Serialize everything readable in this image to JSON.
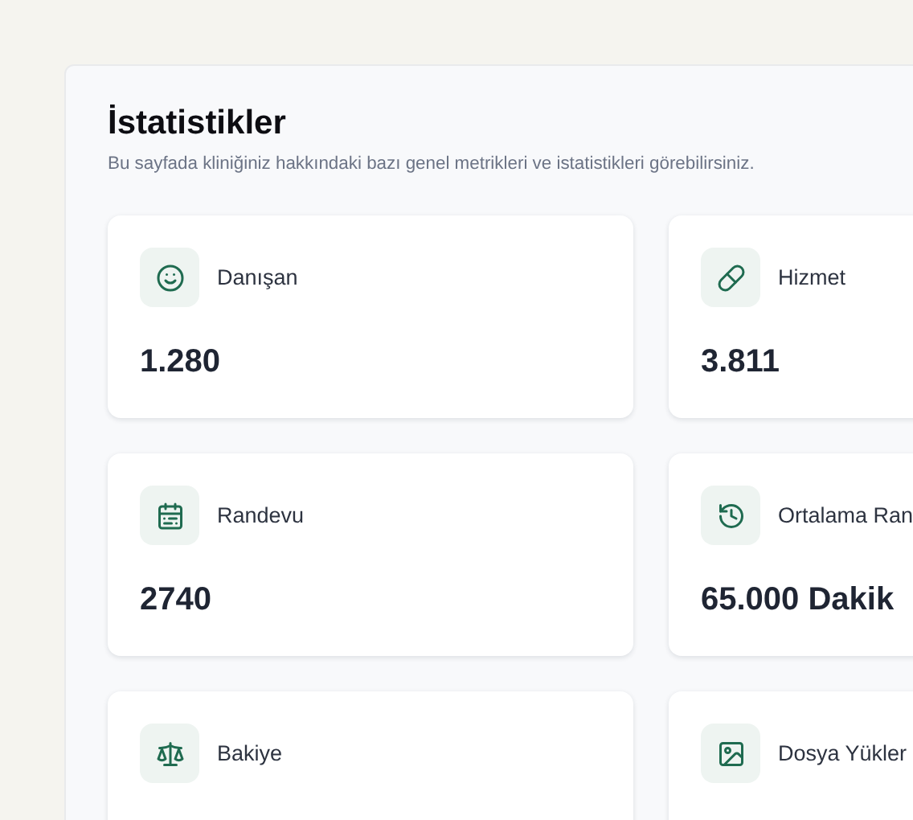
{
  "panel": {
    "title": "İstatistikler",
    "subtitle": "Bu sayfada kliniğiniz hakkındaki bazı genel metrikleri ve istatistikleri görebilirsiniz."
  },
  "stats": [
    {
      "kind": "smile",
      "label": "Danışan",
      "value": "1.280"
    },
    {
      "kind": "pill",
      "label": "Hizmet",
      "value": "3.811"
    },
    {
      "kind": "calendar",
      "label": "Randevu",
      "value": "2740"
    },
    {
      "kind": "history",
      "label": "Ortalama Ran",
      "value": "65.000 Dakik"
    },
    {
      "kind": "scale",
      "label": "Bakiye"
    },
    {
      "kind": "image",
      "label": "Dosya Yükler"
    }
  ]
}
